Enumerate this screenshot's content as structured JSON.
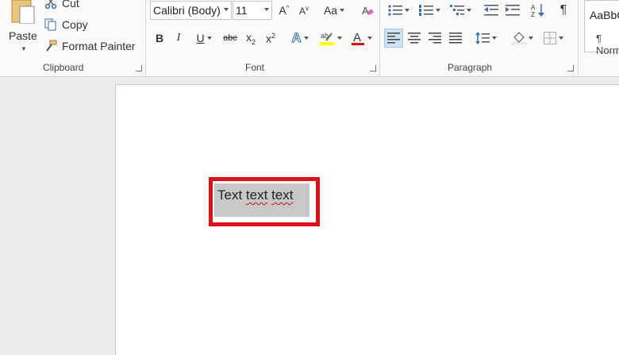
{
  "ribbon": {
    "clipboard": {
      "label": "Clipboard",
      "paste": "Paste",
      "cut": "Cut",
      "copy": "Copy",
      "format_painter": "Format Painter"
    },
    "font": {
      "label": "Font",
      "font_name": "Calibri (Body)",
      "font_size": "11",
      "change_case": "Aa"
    },
    "paragraph": {
      "label": "Paragraph"
    },
    "styles": {
      "sample": "AaBbCcDc",
      "name": "¶ Normal"
    }
  },
  "document": {
    "text_words": [
      "Text",
      "text",
      "text"
    ]
  },
  "colors": {
    "highlight_box": "#e0101b",
    "selection": "#c8c8c8",
    "highlighter": "#ffff00",
    "font_color": "#e01010"
  }
}
